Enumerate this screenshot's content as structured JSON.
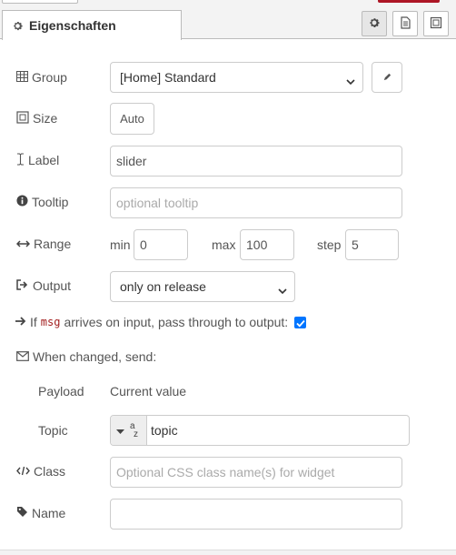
{
  "tabs": {
    "active_label": "Eigenschaften",
    "buttons": [
      {
        "icon": "gear-icon"
      },
      {
        "icon": "document-icon"
      },
      {
        "icon": "frame-icon"
      }
    ]
  },
  "form": {
    "group": {
      "label": "Group",
      "value": "[Home] Standard"
    },
    "size": {
      "label": "Size",
      "value": "Auto"
    },
    "label": {
      "label": "Label",
      "value": "slider"
    },
    "tooltip": {
      "label": "Tooltip",
      "placeholder": "optional tooltip"
    },
    "range": {
      "label": "Range",
      "min_label": "min",
      "min_value": "0",
      "max_label": "max",
      "max_value": "100",
      "step_label": "step",
      "step_value": "5"
    },
    "output": {
      "label": "Output",
      "value": "only on release"
    },
    "passthrough": {
      "pre": "If",
      "code": "msg",
      "post": "arrives on input, pass through to output:",
      "checked": true
    },
    "when_changed": {
      "label": "When changed, send:"
    },
    "payload": {
      "label": "Payload",
      "value": "Current value"
    },
    "topic": {
      "label": "Topic",
      "type_icon_text": "a",
      "type_icon_sub": "z",
      "value": "topic"
    },
    "class": {
      "label": "Class",
      "placeholder": "Optional CSS class name(s) for widget"
    },
    "name": {
      "label": "Name",
      "value": ""
    }
  },
  "colors": {
    "checkbox": "#0075ff",
    "code": "#a32020",
    "accent_red": "#ad1625"
  }
}
